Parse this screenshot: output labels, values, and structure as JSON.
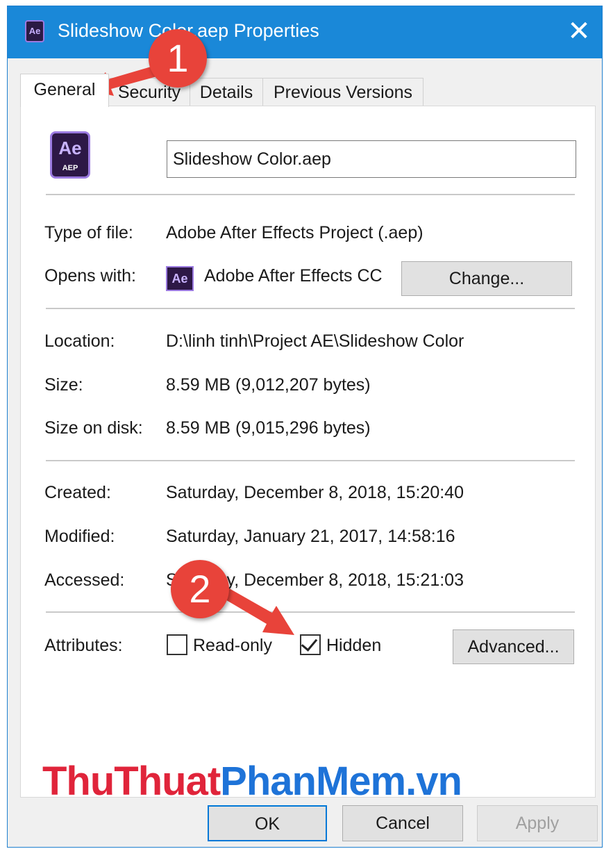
{
  "window": {
    "title": "Slideshow Color.aep Properties",
    "title_icon_text": "Ae",
    "close_glyph": "✕"
  },
  "tabs": [
    {
      "label": "General",
      "active": true
    },
    {
      "label": "Security",
      "active": false
    },
    {
      "label": "Details",
      "active": false
    },
    {
      "label": "Previous Versions",
      "active": false
    }
  ],
  "general": {
    "file_icon": {
      "text": "Ae",
      "ext": "AEP"
    },
    "file_name": "Slideshow Color.aep",
    "type_label": "Type of file:",
    "type_value": "Adobe After Effects Project (.aep)",
    "opens_label": "Opens with:",
    "opens_icon_text": "Ae",
    "opens_value": "Adobe After Effects CC",
    "change_button": "Change...",
    "location_label": "Location:",
    "location_value": "D:\\linh tinh\\Project AE\\Slideshow Color",
    "size_label": "Size:",
    "size_value": "8.59 MB (9,012,207 bytes)",
    "size_on_disk_label": "Size on disk:",
    "size_on_disk_value": "8.59 MB (9,015,296 bytes)",
    "created_label": "Created:",
    "created_value": "Saturday, December 8, 2018, 15:20:40",
    "modified_label": "Modified:",
    "modified_value": "Saturday, January 21, 2017, 14:58:16",
    "accessed_label": "Accessed:",
    "accessed_value": "Saturday, December 8, 2018, 15:21:03",
    "attributes_label": "Attributes:",
    "readonly_label": "Read-only",
    "readonly_checked": false,
    "hidden_label": "Hidden",
    "hidden_checked": true,
    "advanced_button": "Advanced..."
  },
  "buttons": {
    "ok": "OK",
    "cancel": "Cancel",
    "apply": "Apply",
    "apply_enabled": false
  },
  "annotations": {
    "step1": "1",
    "step2": "2",
    "color": "#e8433a"
  },
  "watermark": {
    "part1": "ThuThuat",
    "part2": "PhanMem.vn"
  },
  "colors": {
    "titlebar": "#1a88d8",
    "dialog_bg": "#f0f0f0",
    "ae_purple": "#2d1846"
  }
}
